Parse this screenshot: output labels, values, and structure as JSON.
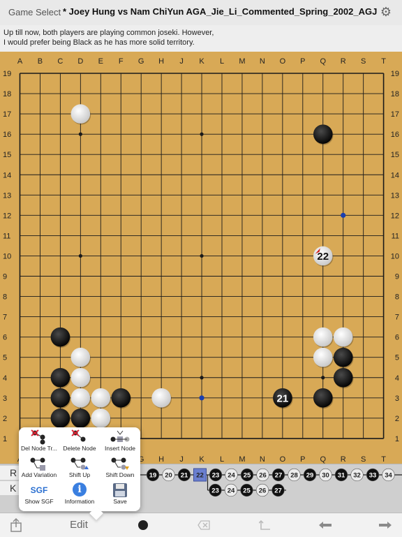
{
  "header": {
    "game_select": "Game Select",
    "title": "* Joey Hung vs Nam ChiYun  AGA_Jie_Li_Commented_Spring_2002_AGJ",
    "settings_icon": "gear-icon"
  },
  "comment": {
    "line1": "Up till now, both players are playing common joseki. However,",
    "line2": "I would prefer being Black as he has more solid territory."
  },
  "board": {
    "size": 19,
    "columns": [
      "A",
      "B",
      "C",
      "D",
      "E",
      "F",
      "G",
      "H",
      "J",
      "K",
      "L",
      "M",
      "N",
      "O",
      "P",
      "Q",
      "R",
      "S",
      "T"
    ],
    "rows": [
      "19",
      "18",
      "17",
      "16",
      "15",
      "14",
      "13",
      "12",
      "11",
      "10",
      "9",
      "8",
      "7",
      "6",
      "5",
      "4",
      "3",
      "2",
      "1"
    ],
    "stones": [
      {
        "c": "D",
        "r": 17,
        "color": "white"
      },
      {
        "c": "Q",
        "r": 16,
        "color": "black"
      },
      {
        "c": "Q",
        "r": 10,
        "color": "white",
        "label": "22",
        "last": true
      },
      {
        "c": "C",
        "r": 6,
        "color": "black"
      },
      {
        "c": "Q",
        "r": 6,
        "color": "white"
      },
      {
        "c": "R",
        "r": 6,
        "color": "white"
      },
      {
        "c": "D",
        "r": 5,
        "color": "white"
      },
      {
        "c": "Q",
        "r": 5,
        "color": "white"
      },
      {
        "c": "R",
        "r": 5,
        "color": "black"
      },
      {
        "c": "C",
        "r": 4,
        "color": "black"
      },
      {
        "c": "D",
        "r": 4,
        "color": "white"
      },
      {
        "c": "R",
        "r": 4,
        "color": "black"
      },
      {
        "c": "C",
        "r": 3,
        "color": "black"
      },
      {
        "c": "D",
        "r": 3,
        "color": "white"
      },
      {
        "c": "E",
        "r": 3,
        "color": "white"
      },
      {
        "c": "F",
        "r": 3,
        "color": "black"
      },
      {
        "c": "H",
        "r": 3,
        "color": "white"
      },
      {
        "c": "O",
        "r": 3,
        "color": "black",
        "label": "21"
      },
      {
        "c": "Q",
        "r": 3,
        "color": "black"
      },
      {
        "c": "C",
        "r": 2,
        "color": "black"
      },
      {
        "c": "D",
        "r": 2,
        "color": "black"
      },
      {
        "c": "E",
        "r": 2,
        "color": "white"
      }
    ],
    "markers": [
      {
        "c": "R",
        "r": 12,
        "color": "#1a3fb0"
      },
      {
        "c": "K",
        "r": 3,
        "color": "#1a3fb0"
      }
    ]
  },
  "tree": {
    "labels": [
      "R",
      "K"
    ],
    "main_line": [
      {
        "n": "19",
        "color": "black"
      },
      {
        "n": "20",
        "color": "white"
      },
      {
        "n": "21",
        "color": "black"
      },
      {
        "n": "22",
        "color": "white",
        "current": true
      },
      {
        "n": "23",
        "color": "black"
      },
      {
        "n": "24",
        "color": "white"
      },
      {
        "n": "25",
        "color": "black"
      },
      {
        "n": "26",
        "color": "white"
      },
      {
        "n": "27",
        "color": "black"
      },
      {
        "n": "28",
        "color": "white"
      },
      {
        "n": "29",
        "color": "black"
      },
      {
        "n": "30",
        "color": "white"
      },
      {
        "n": "31",
        "color": "black"
      },
      {
        "n": "32",
        "color": "white"
      },
      {
        "n": "33",
        "color": "black"
      },
      {
        "n": "34",
        "color": "white"
      }
    ],
    "variation": [
      {
        "n": "23",
        "color": "black"
      },
      {
        "n": "24",
        "color": "white"
      },
      {
        "n": "25",
        "color": "black"
      },
      {
        "n": "26",
        "color": "white"
      },
      {
        "n": "27",
        "color": "black"
      }
    ]
  },
  "edit_menu": {
    "items": [
      {
        "label": "Del Node Tr...",
        "icon": "delete-node-tree-icon"
      },
      {
        "label": "Delete Node",
        "icon": "delete-node-icon"
      },
      {
        "label": "Insert Node",
        "icon": "insert-node-icon"
      },
      {
        "label": "Add Variation",
        "icon": "add-variation-icon"
      },
      {
        "label": "Shift Up",
        "icon": "shift-up-icon"
      },
      {
        "label": "Shift Down",
        "icon": "shift-down-icon"
      },
      {
        "label": "Show SGF",
        "icon": "sgf-icon",
        "icon_text": "SGF"
      },
      {
        "label": "Information",
        "icon": "info-icon",
        "icon_text": "i"
      },
      {
        "label": "Save",
        "icon": "save-icon"
      }
    ]
  },
  "toolbar": {
    "edit_label": "Edit",
    "share_icon": "share-icon",
    "stone_icon": "stone-icon",
    "clear_icon": "clear-icon",
    "pass_icon": "pass-icon",
    "back_icon": "arrow-left-icon",
    "forward_icon": "arrow-right-icon"
  }
}
